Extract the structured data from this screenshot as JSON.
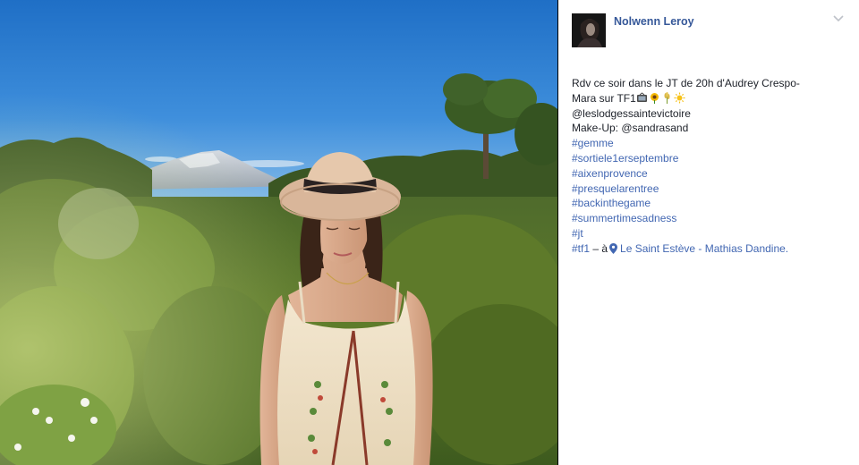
{
  "post": {
    "author": "Nolwenn Leroy",
    "caption": {
      "line1": "Rdv ce soir dans le JT de 20h d'Audrey Crespo-",
      "line2": "Mara sur TF1",
      "emoji_line2": [
        "tv-icon",
        "sunflower-icon",
        "wheat-icon",
        "sun-icon"
      ],
      "line3": "@leslodgessaintevictoire",
      "line4_prefix": "Make-Up:",
      "line4_mention": "@sandrasand"
    },
    "hashtags": [
      "#gemme",
      "#sortiele1erseptembre",
      "#aixenprovence",
      "#presquelarentree",
      "#backinthegame",
      "#summertimesadness",
      "#jt"
    ],
    "last_line": {
      "hashtag": "#tf1",
      "separator": " – à",
      "location": "Le Saint Estève - Mathias Dandine."
    }
  },
  "colors": {
    "author_link": "#365899",
    "hashtag": "#4267b2",
    "body_text": "#1d2129",
    "sky": "#2f7fd0"
  },
  "icons": {
    "chevron": "chevron-down-icon",
    "location": "location-pin-icon"
  }
}
